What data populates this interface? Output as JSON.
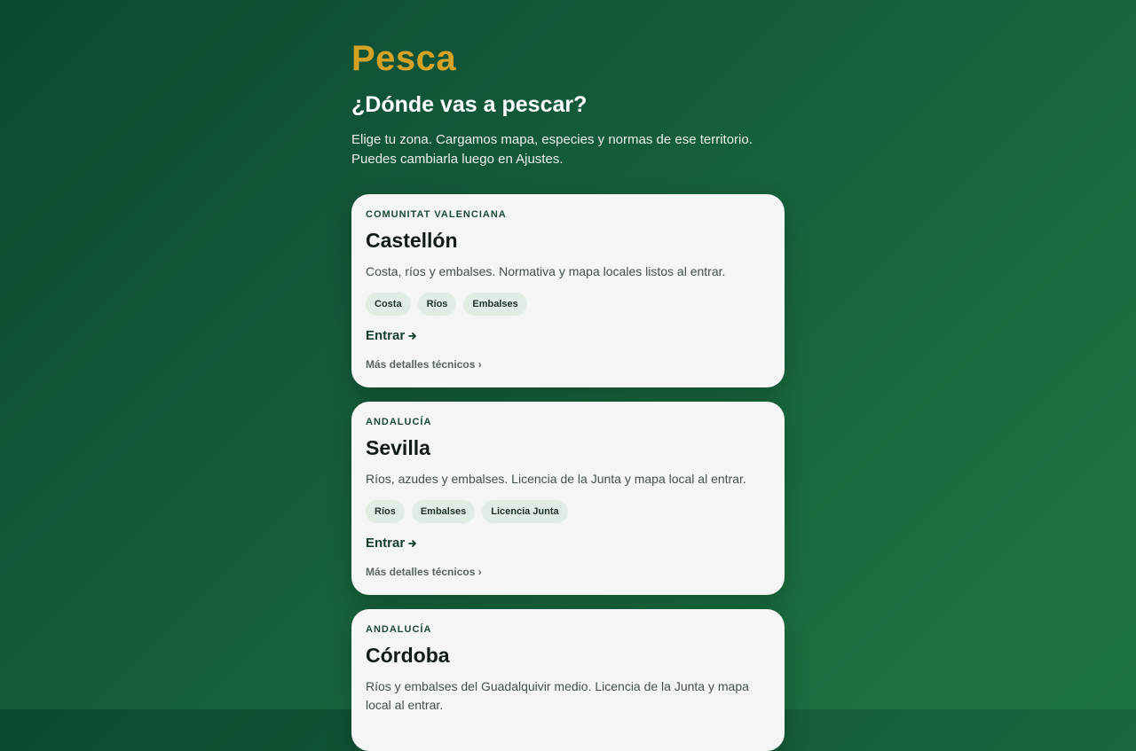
{
  "app": {
    "brand": "Pesca",
    "headline": "¿Dónde vas a pescar?",
    "intro_line1": "Elige tu zona. Cargamos mapa, especies y normas de ese territorio.",
    "intro_line2": "Puedes cambiarla luego en Ajustes."
  },
  "colors": {
    "brand": "#d4a326",
    "background_start": "#0c4a2f",
    "background_end": "#1d7443",
    "card": "#f3f6f4",
    "tag": "#e1ede4"
  },
  "zones": [
    {
      "region": "Comunitat Valenciana",
      "name": "Castellón",
      "description_lines": [
        "Costa, ríos y embalses. Normativa y mapa locales listos al entrar."
      ],
      "tags": [
        "Costa",
        "Ríos",
        "Embalses"
      ],
      "enter_label": "Entrar",
      "enter_icon": "arrow-right-icon",
      "details_label": "Más detalles técnicos ›"
    },
    {
      "region": "Andalucía",
      "name": "Sevilla",
      "description_lines": [
        "Ríos, azudes y embalses. Licencia de la Junta y mapa local al entrar."
      ],
      "tags": [
        "Ríos",
        "Embalses",
        "Licencia Junta"
      ],
      "enter_label": "Entrar",
      "enter_icon": "arrow-right-icon",
      "details_label": "Más detalles técnicos ›"
    },
    {
      "region": "Andalucía",
      "name": "Córdoba",
      "description_lines": [
        "Ríos y embalses del Guadalquivir medio. Licencia de la Junta y mapa",
        "local al entrar."
      ]
    }
  ]
}
